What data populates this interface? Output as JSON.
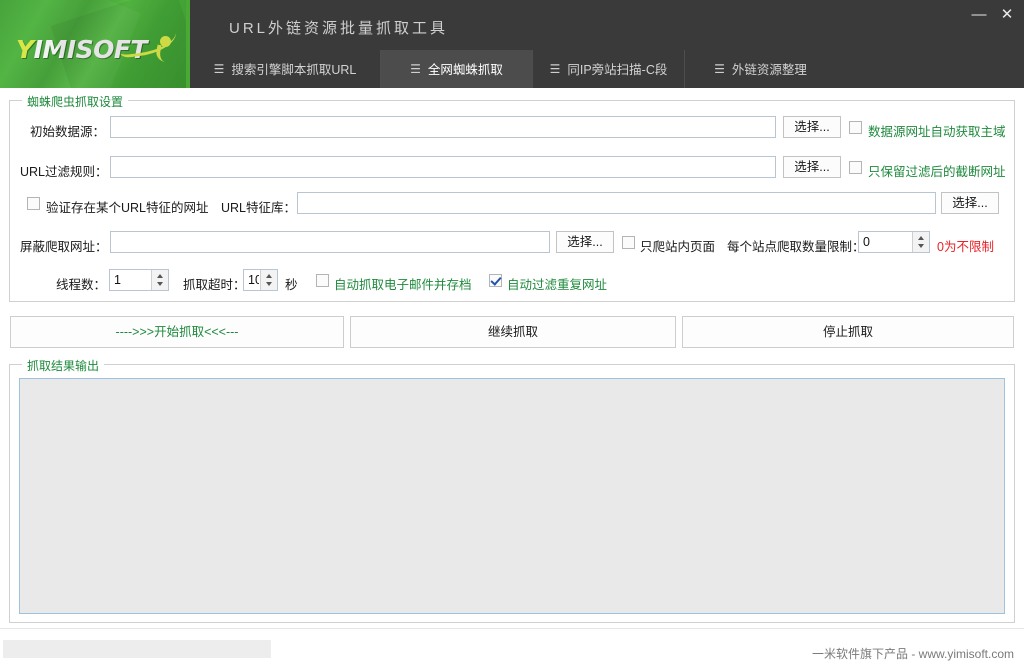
{
  "window": {
    "title": "URL外链资源批量抓取工具",
    "minimize_label": "—",
    "close_label": "✕"
  },
  "brand": {
    "logo_prefix": "Y",
    "logo_text": "IMISOFT"
  },
  "tabs": [
    {
      "label": "搜索引擎脚本抓取URL",
      "icon": "☰",
      "active": false
    },
    {
      "label": "全网蜘蛛抓取",
      "icon": "☰",
      "active": true
    },
    {
      "label": "同IP旁站扫描-C段",
      "icon": "☰",
      "active": false
    },
    {
      "label": "外链资源整理",
      "icon": "☰",
      "active": false
    }
  ],
  "settings_group": {
    "title": "蜘蛛爬虫抓取设置",
    "source_label": "初始数据源：",
    "source_value": "",
    "source_browse_label": "选择...",
    "source_auto_domain_label": "数据源网址自动获取主域",
    "source_auto_domain_checked": false,
    "filter_label": "URL过滤规则：",
    "filter_value": "",
    "filter_browse_label": "选择...",
    "keep_truncated_label": "只保留过滤后的截断网址",
    "keep_truncated_checked": false,
    "verify_feature_label": "验证存在某个URL特征的网址",
    "verify_feature_checked": false,
    "feature_lib_label": "URL特征库：",
    "feature_lib_value": "",
    "feature_lib_browse_label": "选择...",
    "block_label": "屏蔽爬取网址：",
    "block_value": "",
    "block_browse_label": "选择...",
    "only_internal_label": "只爬站内页面",
    "only_internal_checked": false,
    "site_limit_label": "每个站点爬取数量限制：",
    "site_limit_value": "0",
    "site_limit_hint": "0为不限制",
    "threads_label": "线程数：",
    "threads_value": "1",
    "timeout_label": "抓取超时：",
    "timeout_value": "10",
    "timeout_unit": "秒",
    "auto_email_label": "自动抓取电子邮件并存档",
    "auto_email_checked": false,
    "auto_dedup_label": "自动过滤重复网址",
    "auto_dedup_checked": true
  },
  "actions": {
    "start_label": "---->>>开始抓取<<<---",
    "continue_label": "继续抓取",
    "stop_label": "停止抓取"
  },
  "output_group": {
    "title": "抓取结果输出",
    "content": ""
  },
  "statusbar": {
    "text": "",
    "footer": "一米软件旗下产品 - www.yimisoft.com"
  },
  "colors": {
    "brand_green": "#4aa935",
    "header_dark": "#3a3a3a",
    "tab_active": "#4c4c4c",
    "label_green": "#1e8a3c",
    "hint_red": "#e8242a",
    "input_border": "#b9c6d2"
  }
}
